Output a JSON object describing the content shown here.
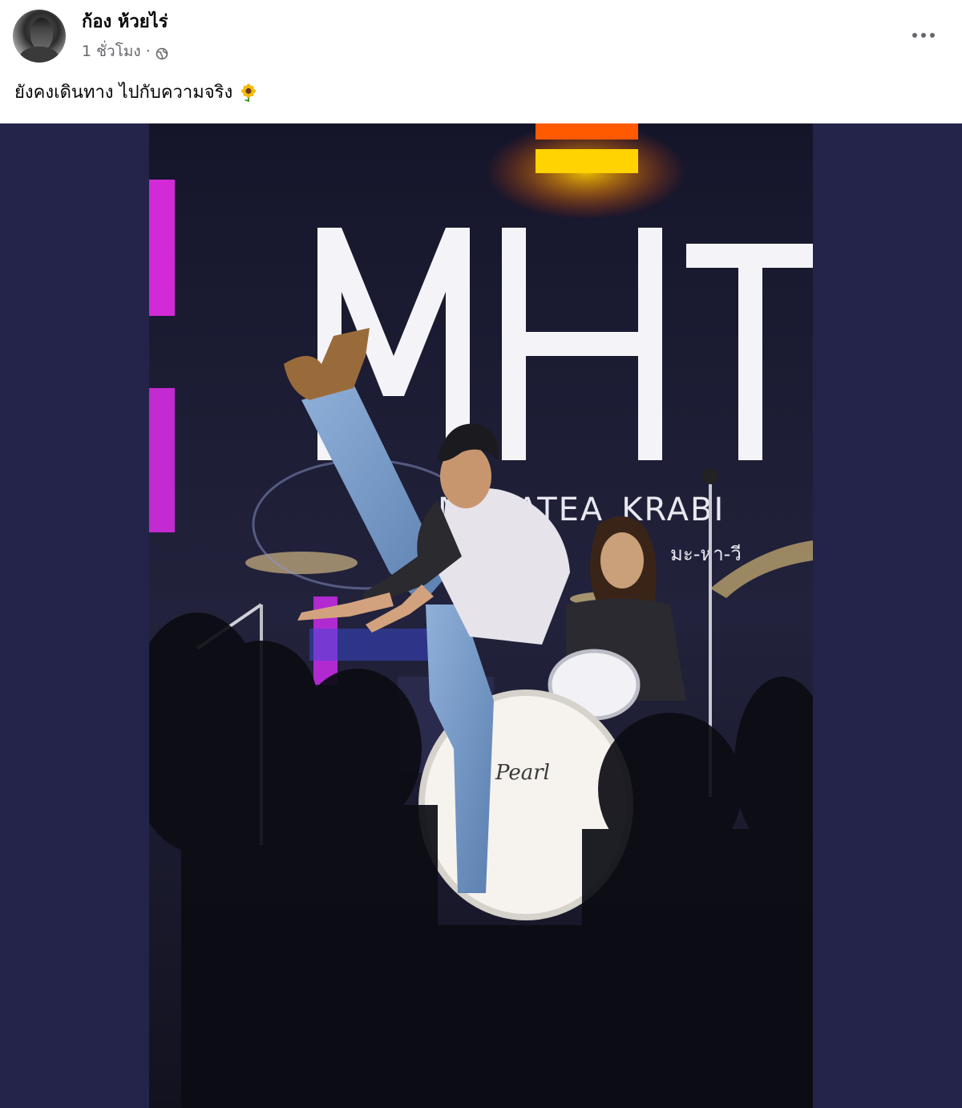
{
  "post": {
    "author": "ก้อง ห้วยไร่",
    "time": "1 ชั่วโมง",
    "separator": "·",
    "audience_icon": "globe-icon",
    "caption": "ยังคงเดินทาง ไปกับความจริง",
    "caption_emoji": "sunflower-icon",
    "more_icon": "more-options-icon"
  },
  "photo": {
    "sign_text": "MHT",
    "sign_subtext": "MAHATEA_KRABI",
    "sign_thai": "มะ-หา-วี",
    "drum_brand": "Pearl"
  },
  "colors": {
    "frame_bg": "#24244a",
    "secondary_text": "#65676b",
    "primary_text": "#050505"
  }
}
